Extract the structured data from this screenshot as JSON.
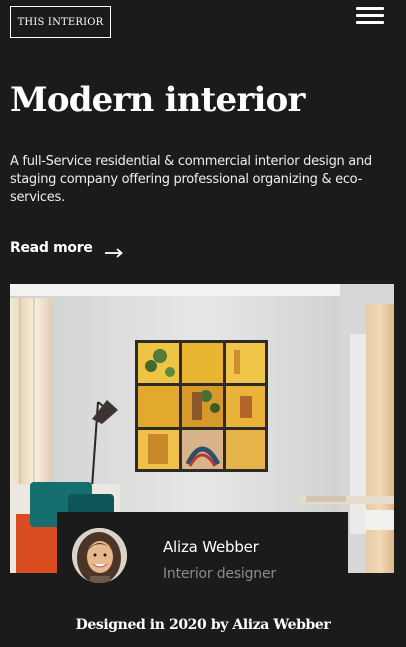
{
  "header": {
    "logo_text": "THIS INTERIOR",
    "menu_icon": "hamburger-menu-icon"
  },
  "hero": {
    "title": "Modern interior",
    "description": "A full-Service residential & commercial interior design and staging company offering professional organizing & eco-services.",
    "read_more_label": "Read more",
    "read_more_icon": "arrow-right-icon"
  },
  "profile": {
    "name": "Aliza Webber",
    "role": "Interior designer"
  },
  "footer": {
    "credit": "Designed in 2020 by Aliza Webber"
  },
  "colors": {
    "background": "#1b1b1c",
    "text": "#ffffff",
    "muted_text": "#8c8c8c"
  }
}
